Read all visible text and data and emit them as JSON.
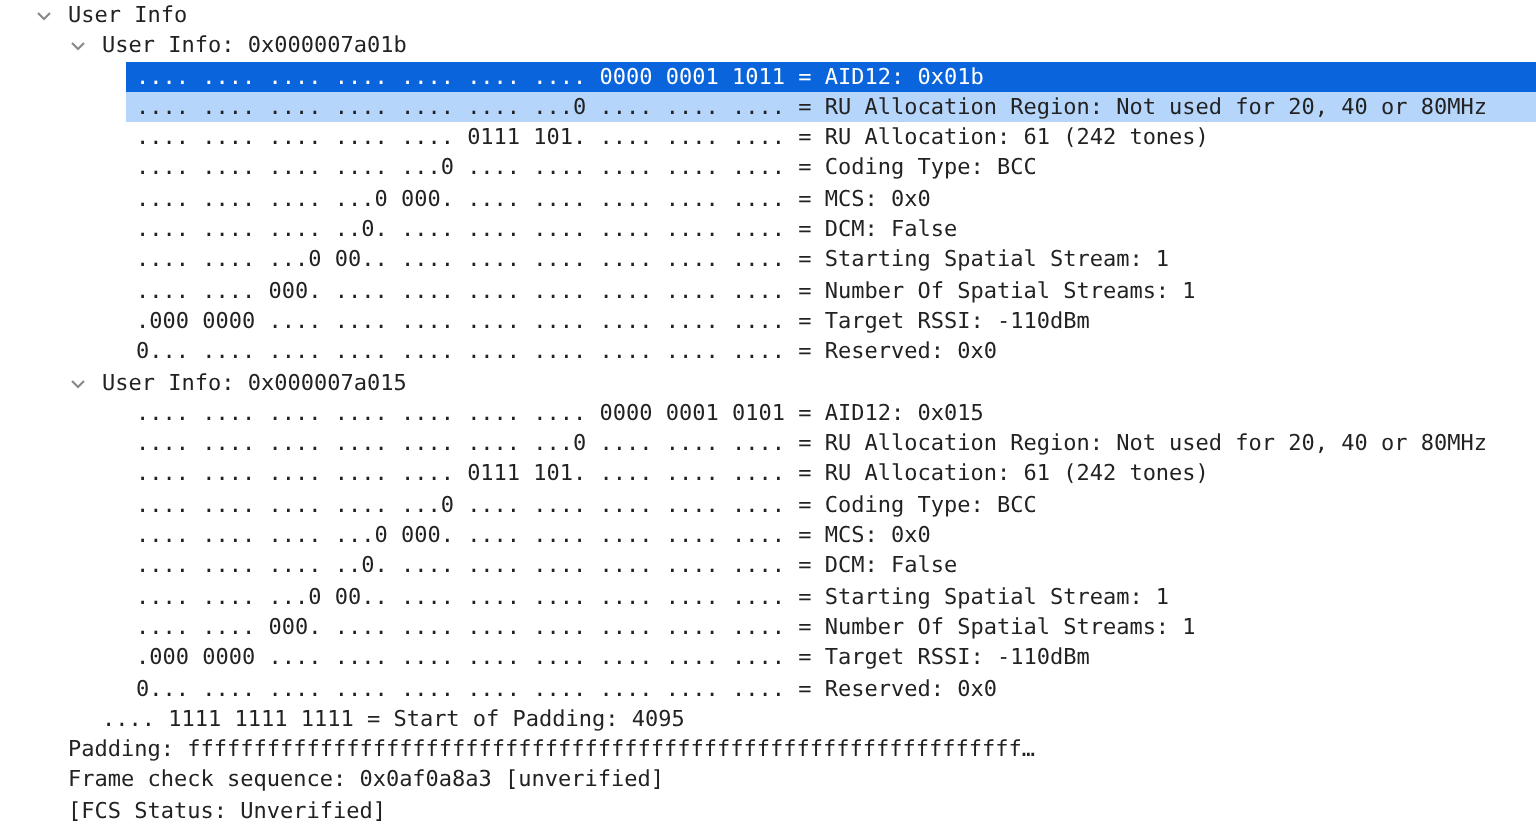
{
  "tree": [
    {
      "label": "User Info",
      "expanded": true,
      "selected": false,
      "highlighted": false,
      "children": [
        {
          "label": "User Info: 0x000007a01b",
          "expanded": true,
          "selected": false,
          "highlighted": false,
          "children": [
            {
              "label": ".... .... .... .... .... .... .... 0000 0001 1011 = AID12: 0x01b",
              "selected": true,
              "highlighted": false
            },
            {
              "label": ".... .... .... .... .... .... ...0 .... .... .... = RU Allocation Region: Not used for 20, 40 or 80MHz",
              "selected": false,
              "highlighted": true
            },
            {
              "label": ".... .... .... .... .... 0111 101. .... .... .... = RU Allocation: 61 (242 tones)",
              "selected": false,
              "highlighted": false
            },
            {
              "label": ".... .... .... .... ...0 .... .... .... .... .... = Coding Type: BCC",
              "selected": false,
              "highlighted": false
            },
            {
              "label": ".... .... .... ...0 000. .... .... .... .... .... = MCS: 0x0",
              "selected": false,
              "highlighted": false
            },
            {
              "label": ".... .... .... ..0. .... .... .... .... .... .... = DCM: False",
              "selected": false,
              "highlighted": false
            },
            {
              "label": ".... .... ...0 00.. .... .... .... .... .... .... = Starting Spatial Stream: 1",
              "selected": false,
              "highlighted": false
            },
            {
              "label": ".... .... 000. .... .... .... .... .... .... .... = Number Of Spatial Streams: 1",
              "selected": false,
              "highlighted": false
            },
            {
              "label": ".000 0000 .... .... .... .... .... .... .... .... = Target RSSI: -110dBm",
              "selected": false,
              "highlighted": false
            },
            {
              "label": "0... .... .... .... .... .... .... .... .... .... = Reserved: 0x0",
              "selected": false,
              "highlighted": false
            }
          ]
        },
        {
          "label": "User Info: 0x000007a015",
          "expanded": true,
          "selected": false,
          "highlighted": false,
          "children": [
            {
              "label": ".... .... .... .... .... .... .... 0000 0001 0101 = AID12: 0x015",
              "selected": false,
              "highlighted": false
            },
            {
              "label": ".... .... .... .... .... .... ...0 .... .... .... = RU Allocation Region: Not used for 20, 40 or 80MHz",
              "selected": false,
              "highlighted": false
            },
            {
              "label": ".... .... .... .... .... 0111 101. .... .... .... = RU Allocation: 61 (242 tones)",
              "selected": false,
              "highlighted": false
            },
            {
              "label": ".... .... .... .... ...0 .... .... .... .... .... = Coding Type: BCC",
              "selected": false,
              "highlighted": false
            },
            {
              "label": ".... .... .... ...0 000. .... .... .... .... .... = MCS: 0x0",
              "selected": false,
              "highlighted": false
            },
            {
              "label": ".... .... .... ..0. .... .... .... .... .... .... = DCM: False",
              "selected": false,
              "highlighted": false
            },
            {
              "label": ".... .... ...0 00.. .... .... .... .... .... .... = Starting Spatial Stream: 1",
              "selected": false,
              "highlighted": false
            },
            {
              "label": ".... .... 000. .... .... .... .... .... .... .... = Number Of Spatial Streams: 1",
              "selected": false,
              "highlighted": false
            },
            {
              "label": ".000 0000 .... .... .... .... .... .... .... .... = Target RSSI: -110dBm",
              "selected": false,
              "highlighted": false
            },
            {
              "label": "0... .... .... .... .... .... .... .... .... .... = Reserved: 0x0",
              "selected": false,
              "highlighted": false
            }
          ]
        },
        {
          "label": ".... 1111 1111 1111 = Start of Padding: 4095",
          "selected": false,
          "highlighted": false
        }
      ]
    },
    {
      "label": "Padding: fffffffffffffffffffffffffffffffffffffffffffffffffffffffffffffff…",
      "selected": false,
      "highlighted": false
    },
    {
      "label": "Frame check sequence: 0x0af0a8a3 [unverified]",
      "selected": false,
      "highlighted": false
    },
    {
      "label": "[FCS Status: Unverified]",
      "selected": false,
      "highlighted": false
    }
  ]
}
